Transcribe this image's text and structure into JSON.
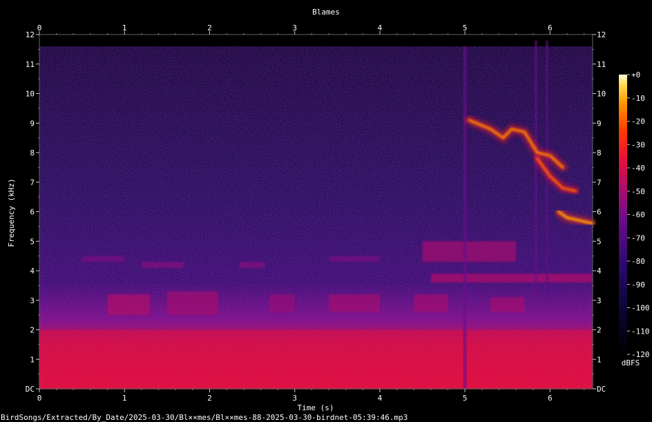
{
  "chart_data": {
    "type": "heatmap",
    "title": "Blames",
    "xlabel": "Time (s)",
    "ylabel": "Frequency (kHz)",
    "xlim": [
      0,
      6.5
    ],
    "ylim": [
      0,
      12
    ],
    "x_ticks": [
      "0",
      "1",
      "2",
      "3",
      "4",
      "5",
      "6"
    ],
    "y_ticks": [
      "DC",
      "1",
      "2",
      "3",
      "4",
      "5",
      "6",
      "7",
      "8",
      "9",
      "10",
      "11",
      "12"
    ],
    "colorbar": {
      "label": "dBFS",
      "range": [
        -120,
        0
      ],
      "ticks": [
        "+0",
        "-10",
        "-20",
        "-30",
        "-40",
        "-50",
        "-60",
        "-70",
        "-80",
        "-90",
        "-100",
        "-110",
        "-120"
      ]
    },
    "colors": {
      "background": "#000000",
      "low": "#000010",
      "mid_low": "#2a0a6e",
      "mid": "#8a0f8f",
      "mid_high": "#e8103a",
      "high": "#ff8a00",
      "peak": "#ffffc8"
    },
    "events": [
      {
        "type": "noise_floor",
        "t_start": 0,
        "t_end": 6.5,
        "f_low": 0,
        "f_high": 2,
        "level_db": -50
      },
      {
        "type": "syllable",
        "t_start": 0.8,
        "t_end": 1.3,
        "f_low": 2.5,
        "f_high": 3.2,
        "level_db": -60
      },
      {
        "type": "syllable",
        "t_start": 1.5,
        "t_end": 2.1,
        "f_low": 2.5,
        "f_high": 3.3,
        "level_db": -62
      },
      {
        "type": "syllable",
        "t_start": 2.7,
        "t_end": 3.0,
        "f_low": 2.6,
        "f_high": 3.2,
        "level_db": -64
      },
      {
        "type": "syllable",
        "t_start": 3.4,
        "t_end": 4.0,
        "f_low": 2.6,
        "f_high": 3.2,
        "level_db": -62
      },
      {
        "type": "syllable",
        "t_start": 4.4,
        "t_end": 4.8,
        "f_low": 2.6,
        "f_high": 3.2,
        "level_db": -62
      },
      {
        "type": "syllable",
        "t_start": 5.3,
        "t_end": 5.7,
        "f_low": 2.6,
        "f_high": 3.1,
        "level_db": -62
      },
      {
        "type": "tone",
        "t_start": 0.5,
        "t_end": 1.0,
        "f_low": 4.3,
        "f_high": 4.5,
        "level_db": -68
      },
      {
        "type": "tone",
        "t_start": 1.2,
        "t_end": 1.7,
        "f_low": 4.1,
        "f_high": 4.3,
        "level_db": -66
      },
      {
        "type": "tone",
        "t_start": 2.35,
        "t_end": 2.65,
        "f_low": 4.1,
        "f_high": 4.3,
        "level_db": -66
      },
      {
        "type": "tone",
        "t_start": 3.4,
        "t_end": 4.0,
        "f_low": 4.3,
        "f_high": 4.5,
        "level_db": -68
      },
      {
        "type": "band",
        "t_start": 4.5,
        "t_end": 5.6,
        "f_low": 4.3,
        "f_high": 5.0,
        "level_db": -62
      },
      {
        "type": "band",
        "t_start": 4.6,
        "t_end": 6.5,
        "f_low": 3.6,
        "f_high": 3.9,
        "level_db": -60
      },
      {
        "type": "vertical_click",
        "t_start": 4.98,
        "t_end": 5.02,
        "f_low": 0,
        "f_high": 11.6,
        "level_db": -70
      },
      {
        "type": "vertical_click",
        "t_start": 5.82,
        "t_end": 5.85,
        "f_low": 3,
        "f_high": 11.8,
        "level_db": -70
      },
      {
        "type": "vertical_click",
        "t_start": 5.95,
        "t_end": 5.98,
        "f_low": 3,
        "f_high": 11.8,
        "level_db": -72
      },
      {
        "type": "call_trace",
        "points": [
          [
            5.05,
            9.1
          ],
          [
            5.3,
            8.8
          ],
          [
            5.45,
            8.5
          ],
          [
            5.55,
            8.8
          ],
          [
            5.7,
            8.7
          ],
          [
            5.85,
            8.0
          ],
          [
            6.0,
            7.9
          ],
          [
            6.15,
            7.5
          ]
        ],
        "level_db": -25
      },
      {
        "type": "call_trace",
        "points": [
          [
            5.85,
            7.8
          ],
          [
            6.0,
            7.2
          ],
          [
            6.15,
            6.8
          ],
          [
            6.3,
            6.7
          ]
        ],
        "level_db": -30
      },
      {
        "type": "call_trace",
        "points": [
          [
            6.1,
            6.0
          ],
          [
            6.2,
            5.8
          ],
          [
            6.35,
            5.7
          ],
          [
            6.5,
            5.6
          ]
        ],
        "level_db": -20
      }
    ]
  },
  "footer": {
    "file_path": "BirdSongs/Extracted/By_Date/2025-03-30/Bl××mes/Bl××mes-88-2025-03-30-birdnet-05:39:46.mp3"
  }
}
